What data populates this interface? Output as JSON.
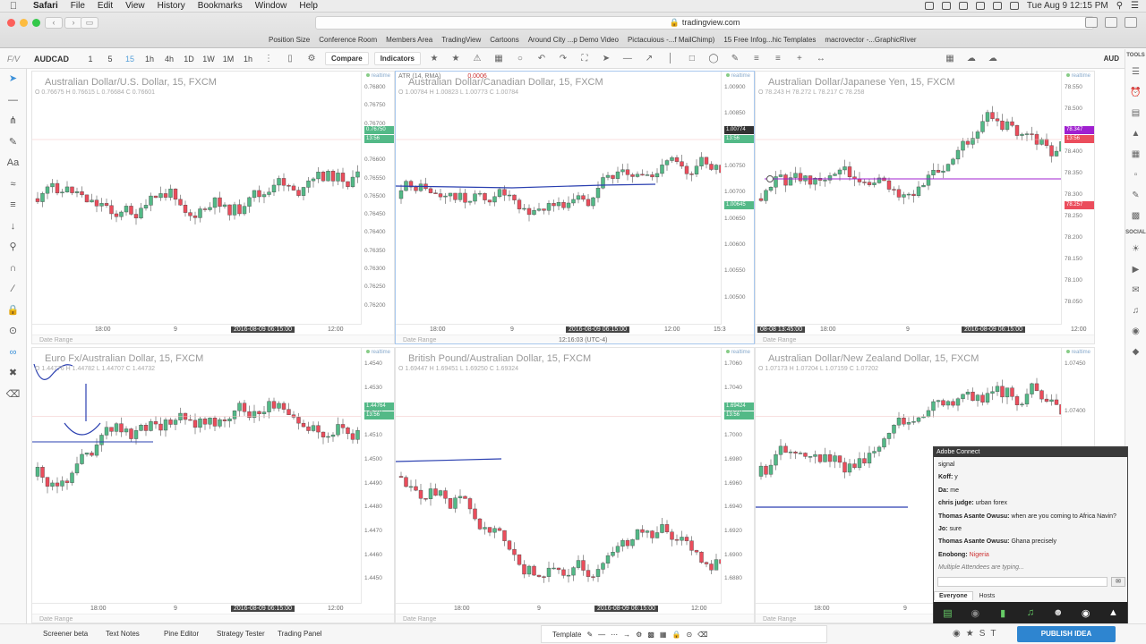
{
  "menubar": {
    "app": "Safari",
    "items": [
      "File",
      "Edit",
      "View",
      "History",
      "Bookmarks",
      "Window",
      "Help"
    ],
    "clock": "Tue Aug 9  12:15 PM"
  },
  "browser": {
    "url": "tradingview.com",
    "bookmarks": [
      "Position Size",
      "Conference Room",
      "Members Area",
      "TradingView",
      "Cartoons",
      "Around City ...p Demo Video",
      "Pictacuious -...f MailChimp)",
      "15 Free Infog...hic Templates",
      "macrovector -...GraphicRiver"
    ]
  },
  "toolbar": {
    "logo": "F/V",
    "symbol": "AUDCAD",
    "timeframes": [
      "1",
      "5",
      "15",
      "1h",
      "4h",
      "1D",
      "1W",
      "1M",
      "1h"
    ],
    "active_tf": "15",
    "compare": "Compare",
    "indicators": "Indicators",
    "currency": "AUD"
  },
  "right_toolbar": {
    "tools": "TOOLS",
    "social": "SOCIAL"
  },
  "panels": [
    {
      "title": "Australian Dollar/U.S. Dollar, 15, FXCM",
      "ohlc": "O 0.76675  H 0.76615  L 0.76684  C 0.76601",
      "prices": [
        "0.76800",
        "0.76750",
        "0.76700",
        "0.76650",
        "0.76600",
        "0.76550",
        "0.76500",
        "0.76450",
        "0.76400",
        "0.76350",
        "0.76300",
        "0.76250",
        "0.76200"
      ],
      "badge": "0.76750",
      "badge2": "13:56",
      "times": [
        "18:00",
        "9",
        "2016-08-09 06:15:00",
        "12:00"
      ],
      "footer": "Date Range",
      "realtime": "realtime"
    },
    {
      "title": "Australian Dollar/Canadian Dollar, 15, FXCM",
      "ohlc": "O 1.00784  H 1.00823  L 1.00773  C 1.00784",
      "atr": "ATR (14, RMA)",
      "atr_val": "0.0006",
      "prices": [
        "1.00900",
        "1.00850",
        "1.00800",
        "1.00750",
        "1.00700",
        "1.00650",
        "1.00600",
        "1.00550",
        "1.00500"
      ],
      "badge": "1.00774",
      "badge_hl": "1.00750",
      "badge3": "1.00645",
      "badge2": "13:56",
      "times": [
        "18:00",
        "9",
        "2016-08-09 06:15:00",
        "12:00",
        "15:3"
      ],
      "footer": "Date Range",
      "clock": "12:16:03 (UTC-4)",
      "realtime": "realtime"
    },
    {
      "title": "Australian Dollar/Japanese Yen, 15, FXCM",
      "ohlc": "O 78.243  H 78.272  L 78.217  C 78.258",
      "prices": [
        "78.550",
        "78.500",
        "78.450",
        "78.400",
        "78.350",
        "78.300",
        "78.250",
        "78.200",
        "78.150",
        "78.100",
        "78.050"
      ],
      "badge": "78.347",
      "badge3": "78.257",
      "badge2": "13:56",
      "times": [
        "08-08 13:45:00",
        "18:00",
        "9",
        "2016-08-09 06:15:00",
        "12:00"
      ],
      "footer": "Date Range",
      "realtime": "realtime"
    },
    {
      "title": "Euro Fx/Australian Dollar, 15, FXCM",
      "ohlc": "O 1.44776  H 1.44782  L 1.44707  C 1.44732",
      "prices": [
        "1.4540",
        "1.4530",
        "1.4520",
        "1.4510",
        "1.4500",
        "1.4490",
        "1.4480",
        "1.4470",
        "1.4460",
        "1.4450"
      ],
      "badge": "1.44764",
      "badge2": "13:56",
      "times": [
        "18:00",
        "9",
        "2016-08-09 06:15:00",
        "12:00"
      ],
      "footer": "Date Range",
      "realtime": "realtime"
    },
    {
      "title": "British Pound/Australian Dollar, 15, FXCM",
      "ohlc": "O 1.69447  H 1.69451  L 1.69250  C 1.69324",
      "prices": [
        "1.7060",
        "1.7040",
        "1.7020",
        "1.7000",
        "1.6980",
        "1.6960",
        "1.6940",
        "1.6920",
        "1.6900",
        "1.6880"
      ],
      "badge": "1.69424",
      "badge2": "13:56",
      "times": [
        "18:00",
        "9",
        "2016-08-09 06:15:00",
        "12:00"
      ],
      "footer": "Date Range",
      "realtime": "realtime"
    },
    {
      "title": "Australian Dollar/New Zealand Dollar, 15, FXCM",
      "ohlc": "O 1.07173  H 1.07204  L 1.07159  C 1.07202",
      "prices": [
        "1.07450",
        "1.07400",
        "1.07350",
        "1.07300",
        "1.07250"
      ],
      "times": [
        "18:00",
        "9"
      ],
      "footer": "Date Range",
      "realtime": "realtime"
    }
  ],
  "adobe": {
    "title": "Adobe Connect",
    "messages": [
      {
        "who": "",
        "text": "signal"
      },
      {
        "who": "Koff:",
        "text": "y"
      },
      {
        "who": "Da:",
        "text": "me"
      },
      {
        "who": "chris judge:",
        "text": "urban forex"
      },
      {
        "who": "Thomas Asante Owusu:",
        "text": "when are you coming to Africa Navin?"
      },
      {
        "who": "Jo:",
        "text": "sure"
      },
      {
        "who": "Thomas Asante Owusu:",
        "text": "Ghana precisely"
      },
      {
        "who": "Enobong:",
        "text": "Nigeria"
      }
    ],
    "typing": "Multiple Attendees are typing...",
    "tabs": [
      "Everyone",
      "Hosts"
    ]
  },
  "bottom": {
    "tabs": [
      "Screener beta",
      "Text Notes",
      "Pine Editor",
      "Strategy Tester",
      "Trading Panel"
    ],
    "template": "Template",
    "publish": "PUBLISH IDEA"
  }
}
